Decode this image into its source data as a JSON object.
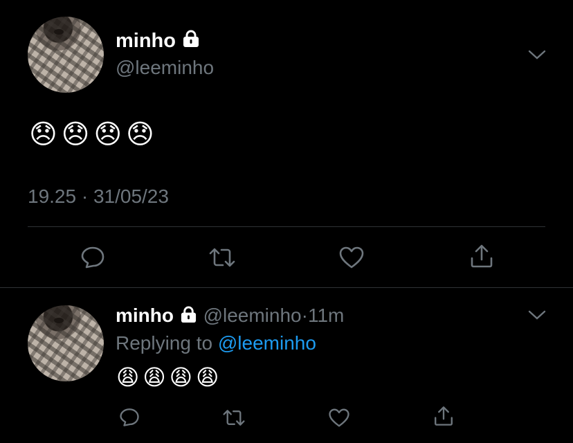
{
  "main_tweet": {
    "display_name": "minho",
    "handle": "@leeminho",
    "text": "😞😞😞😞",
    "timestamp": "19.25 · 31/05/23"
  },
  "reply_tweet": {
    "display_name": "minho",
    "handle": "@leeminho",
    "time_sep": "·",
    "time": "11m",
    "replying_prefix": "Replying to ",
    "replying_handle": "@leeminho",
    "text": "😩😩😩😩"
  },
  "colors": {
    "background": "#000000",
    "muted": "#6e767d",
    "link": "#1d9bf0",
    "divider": "#2f3336"
  },
  "icons": [
    "lock-icon",
    "chevron-down-icon",
    "reply-icon",
    "retweet-icon",
    "like-icon",
    "share-icon"
  ]
}
